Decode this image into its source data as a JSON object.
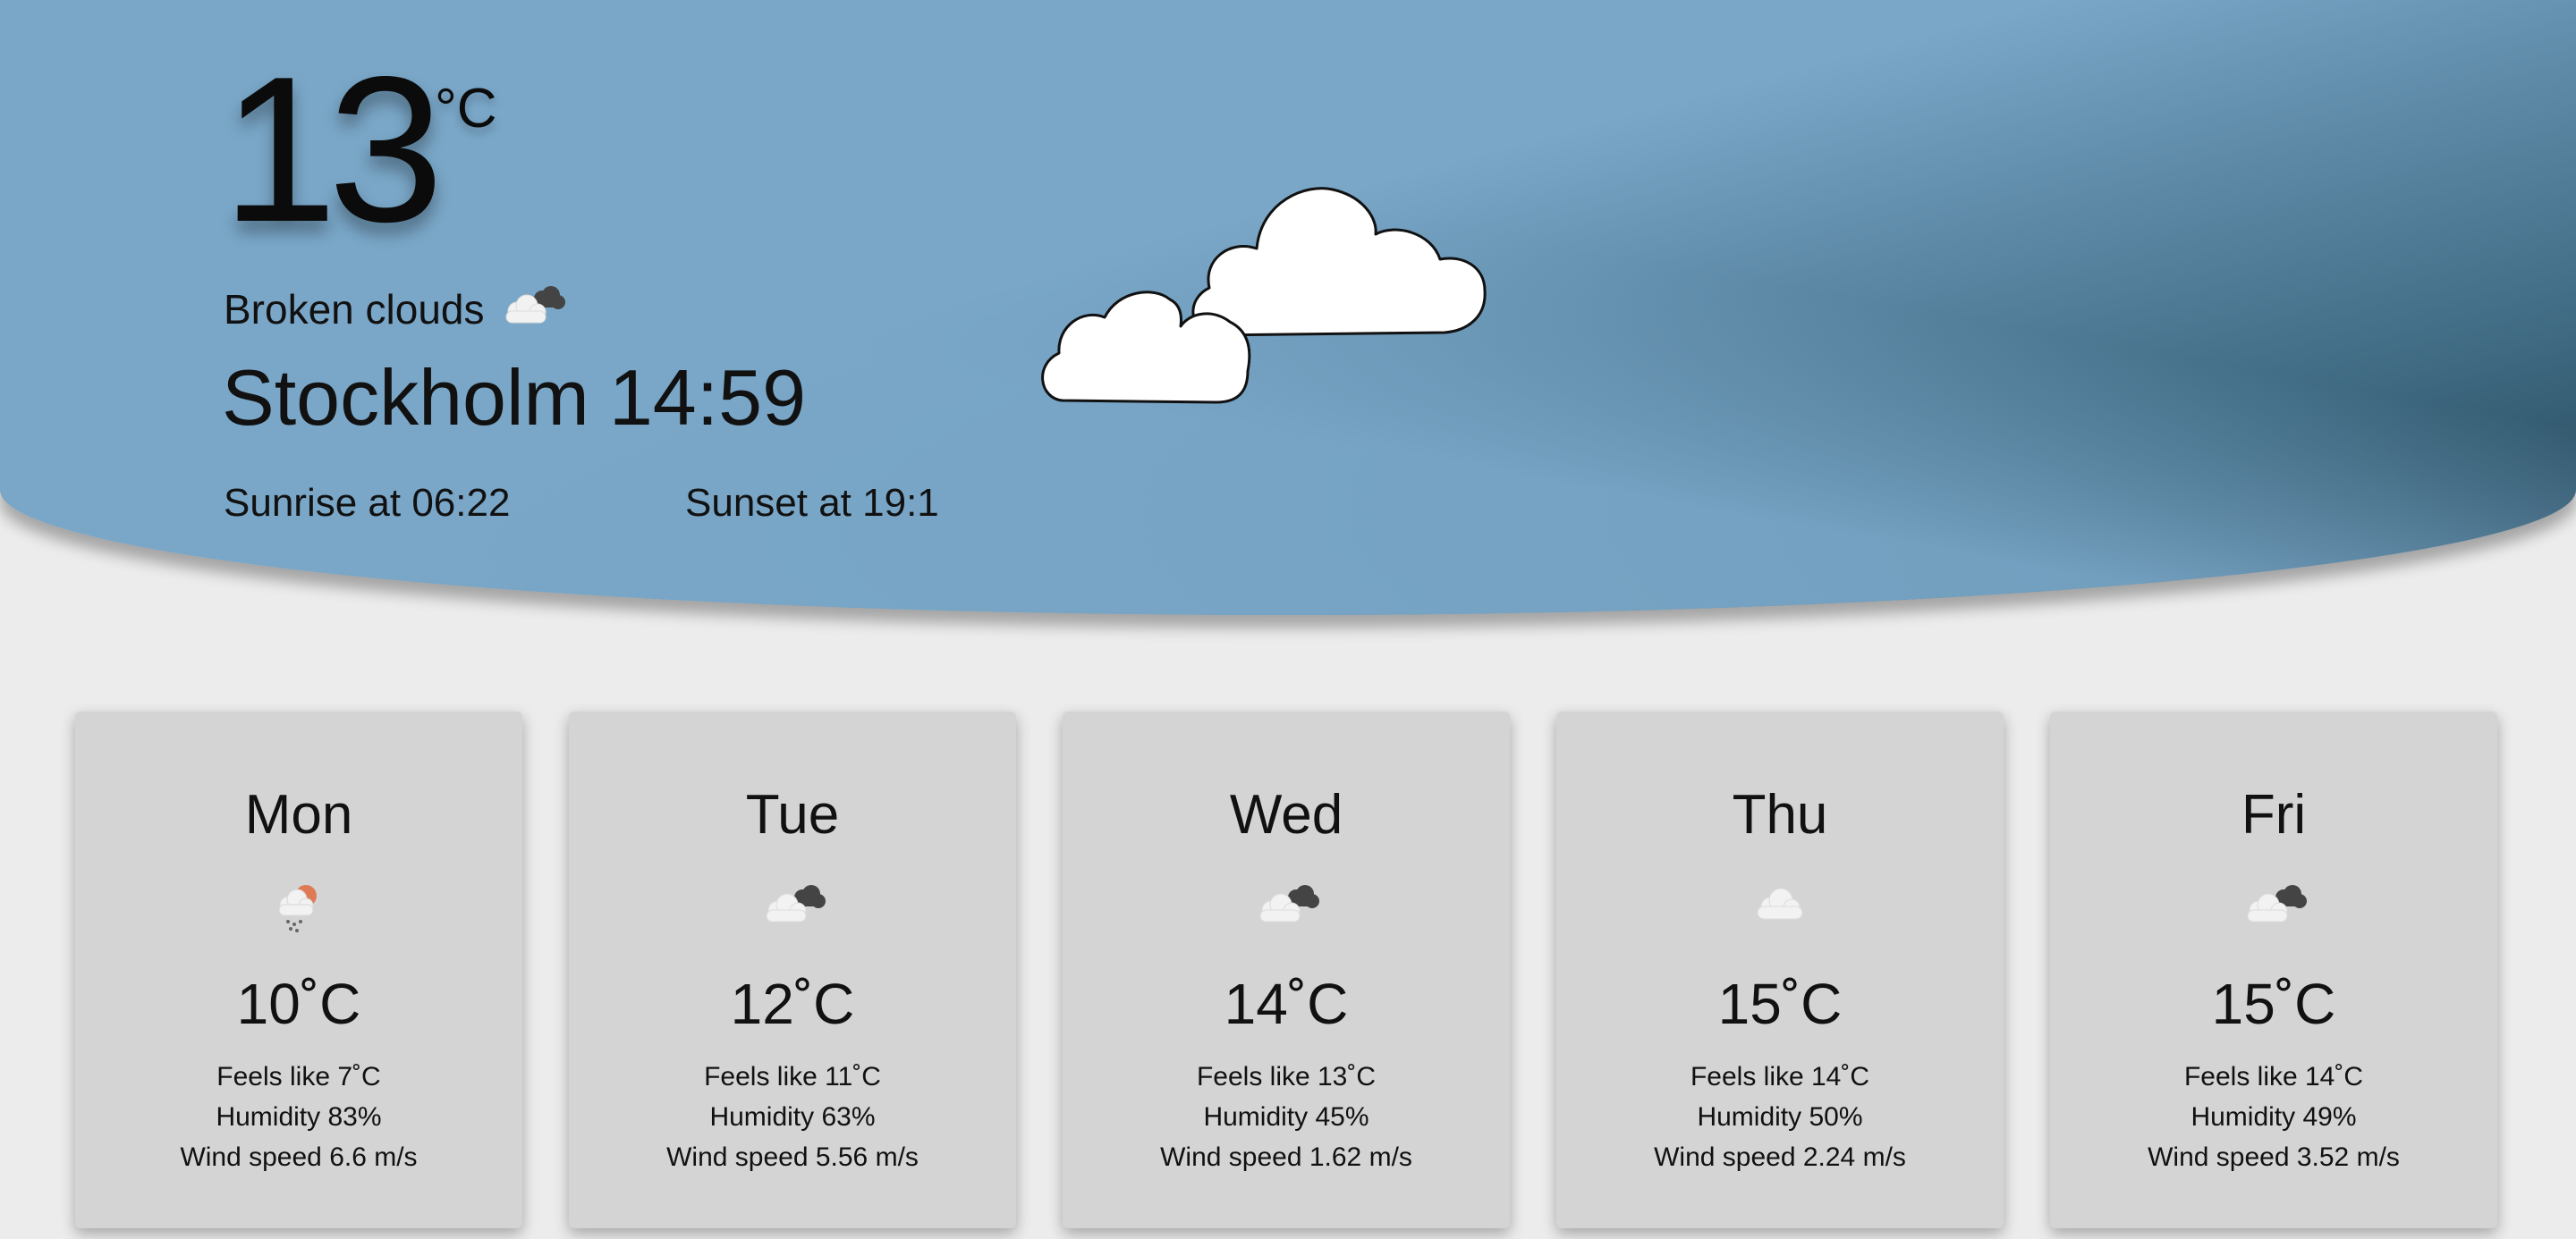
{
  "current": {
    "temperature": "13",
    "unit": "°C",
    "description": "Broken clouds",
    "description_icon": "broken-clouds-icon",
    "city": "Stockholm",
    "time": "14:59",
    "sunrise": "Sunrise at 06:22",
    "sunset": "Sunset at 19:1",
    "illustration": "big-clouds-illustration"
  },
  "forecast": [
    {
      "day": "Mon",
      "icon": "rain-sun-icon",
      "temp": "10˚C",
      "feels": "Feels like 7˚C",
      "humidity": "Humidity 83%",
      "wind": "Wind speed 6.6 m/s"
    },
    {
      "day": "Tue",
      "icon": "broken-clouds-icon",
      "temp": "12˚C",
      "feels": "Feels like 11˚C",
      "humidity": "Humidity 63%",
      "wind": "Wind speed 5.56 m/s"
    },
    {
      "day": "Wed",
      "icon": "broken-clouds-icon",
      "temp": "14˚C",
      "feels": "Feels like 13˚C",
      "humidity": "Humidity 45%",
      "wind": "Wind speed 1.62 m/s"
    },
    {
      "day": "Thu",
      "icon": "cloud-icon",
      "temp": "15˚C",
      "feels": "Feels like 14˚C",
      "humidity": "Humidity 50%",
      "wind": "Wind speed 2.24 m/s"
    },
    {
      "day": "Fri",
      "icon": "broken-clouds-icon",
      "temp": "15˚C",
      "feels": "Feels like 14˚C",
      "humidity": "Humidity 49%",
      "wind": "Wind speed 3.52 m/s"
    }
  ],
  "colors": {
    "hero_blue": "#7aa7c8",
    "hero_dark": "#1f3f4f",
    "card_bg": "#d4d4d4",
    "page_bg": "#ececec"
  }
}
